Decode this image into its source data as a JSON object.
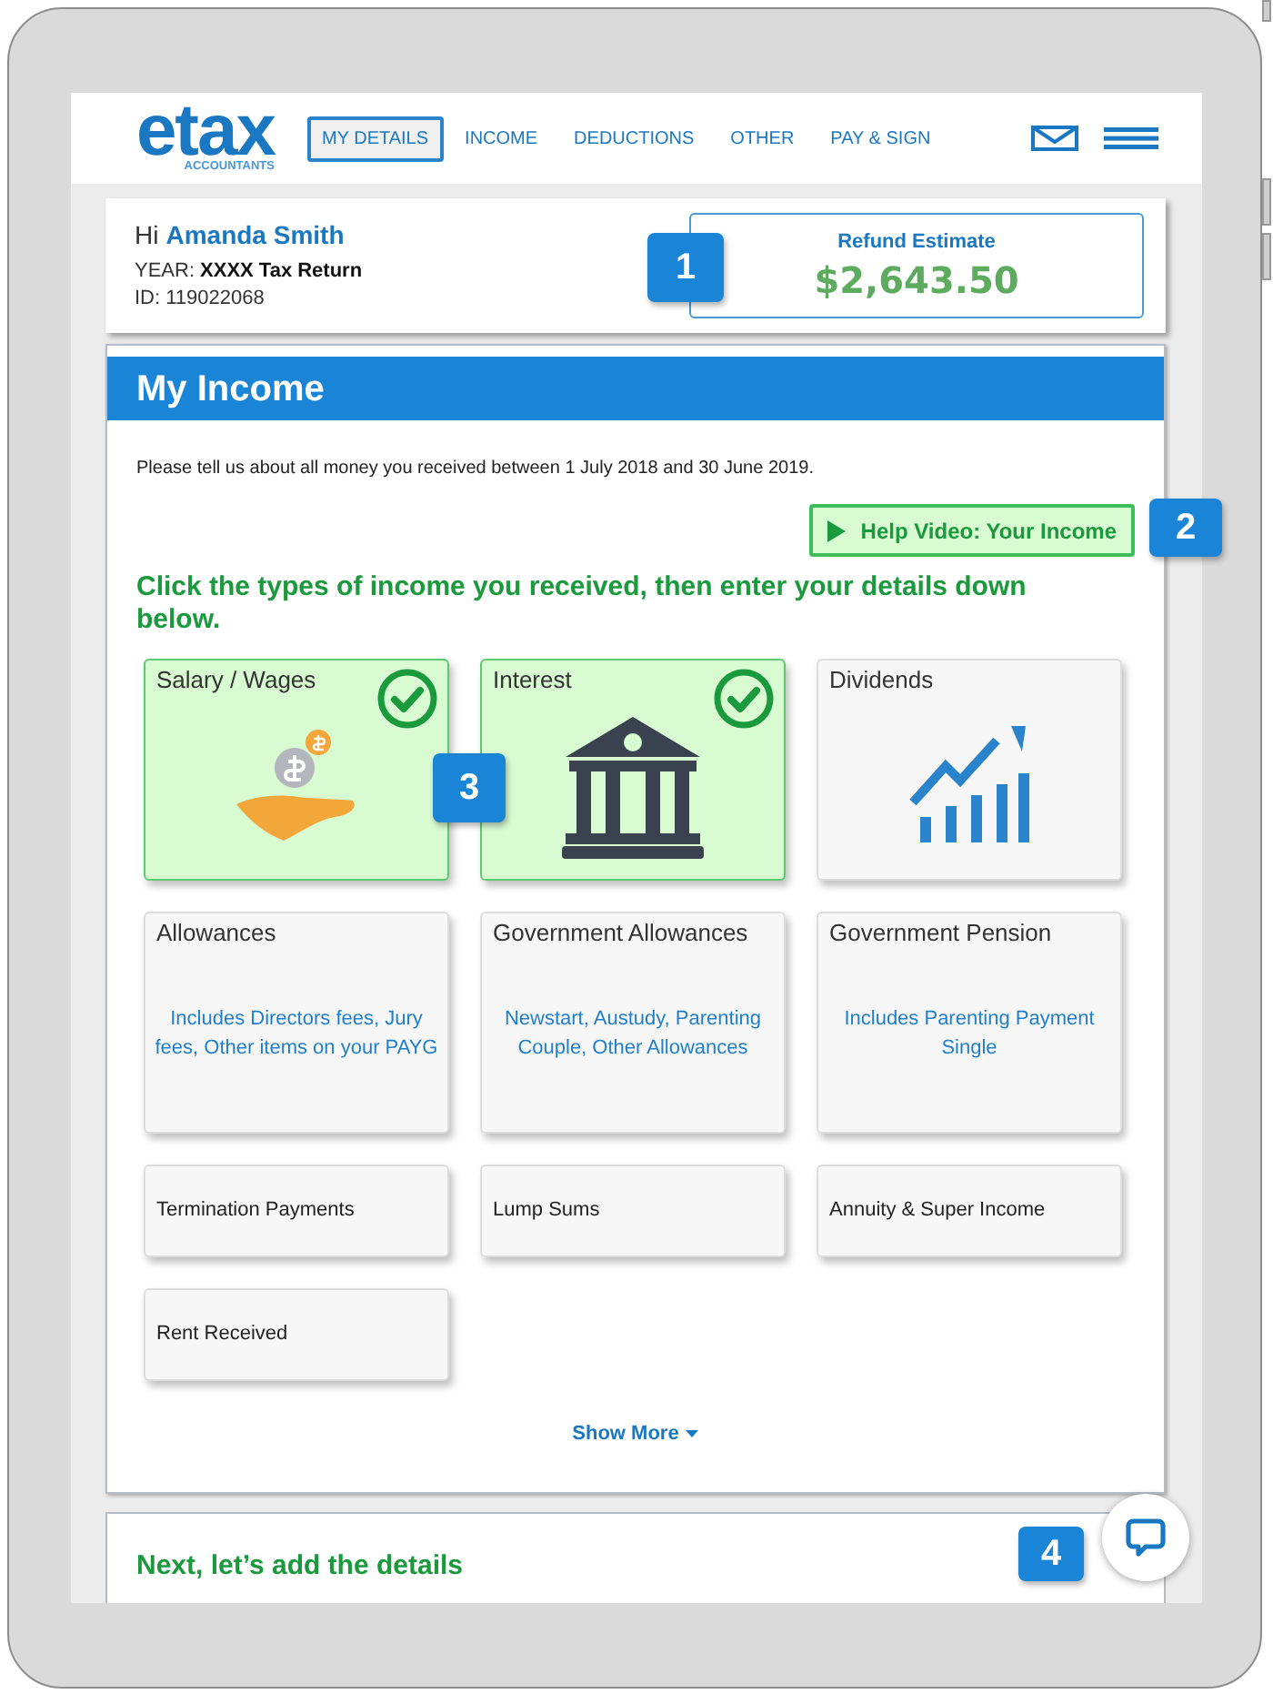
{
  "logo": {
    "wordmark": "etax",
    "tagline": "ACCOUNTANTS"
  },
  "nav": [
    {
      "label": "MY DETAILS",
      "selected": true
    },
    {
      "label": "INCOME",
      "selected": false
    },
    {
      "label": "DEDUCTIONS",
      "selected": false
    },
    {
      "label": "OTHER",
      "selected": false
    },
    {
      "label": "PAY & SIGN",
      "selected": false
    }
  ],
  "user": {
    "greeting": "Hi",
    "name": "Amanda Smith",
    "year_label": "YEAR:",
    "year_value": "XXXX Tax Return",
    "id": "ID: 119022068"
  },
  "refund": {
    "label": "Refund Estimate",
    "amount": "$2,643.50"
  },
  "income": {
    "title": "My Income",
    "intro": "Please tell us about all money you received between 1 July 2018 and 30 June 2019.",
    "help_button": "Help Video: Your Income",
    "instruction": "Click the types of income you received, then enter your details down below.",
    "tiles": [
      {
        "title": "Salary / Wages",
        "kind": "icon",
        "selected": true
      },
      {
        "title": "Interest",
        "kind": "icon",
        "selected": true
      },
      {
        "title": "Dividends",
        "kind": "icon",
        "selected": false
      },
      {
        "title": "Allowances",
        "kind": "note",
        "note": "Includes Directors fees, Jury fees, Other items on your PAYG",
        "selected": false
      },
      {
        "title": "Government Allowances",
        "kind": "note",
        "note": "Newstart, Austudy, Parenting Couple, Other Allowances",
        "selected": false
      },
      {
        "title": "Government Pension",
        "kind": "note",
        "note": "Includes Parenting Payment Single",
        "selected": false
      },
      {
        "title": "Termination Payments",
        "kind": "plain",
        "selected": false
      },
      {
        "title": "Lump Sums",
        "kind": "plain",
        "selected": false
      },
      {
        "title": "Annuity & Super Income",
        "kind": "plain",
        "selected": false
      },
      {
        "title": "Rent Received",
        "kind": "plain",
        "selected": false
      }
    ],
    "show_more": "Show More"
  },
  "next_section": {
    "title": "Next, let’s add the details"
  },
  "callouts": [
    "1",
    "2",
    "3",
    "4"
  ]
}
